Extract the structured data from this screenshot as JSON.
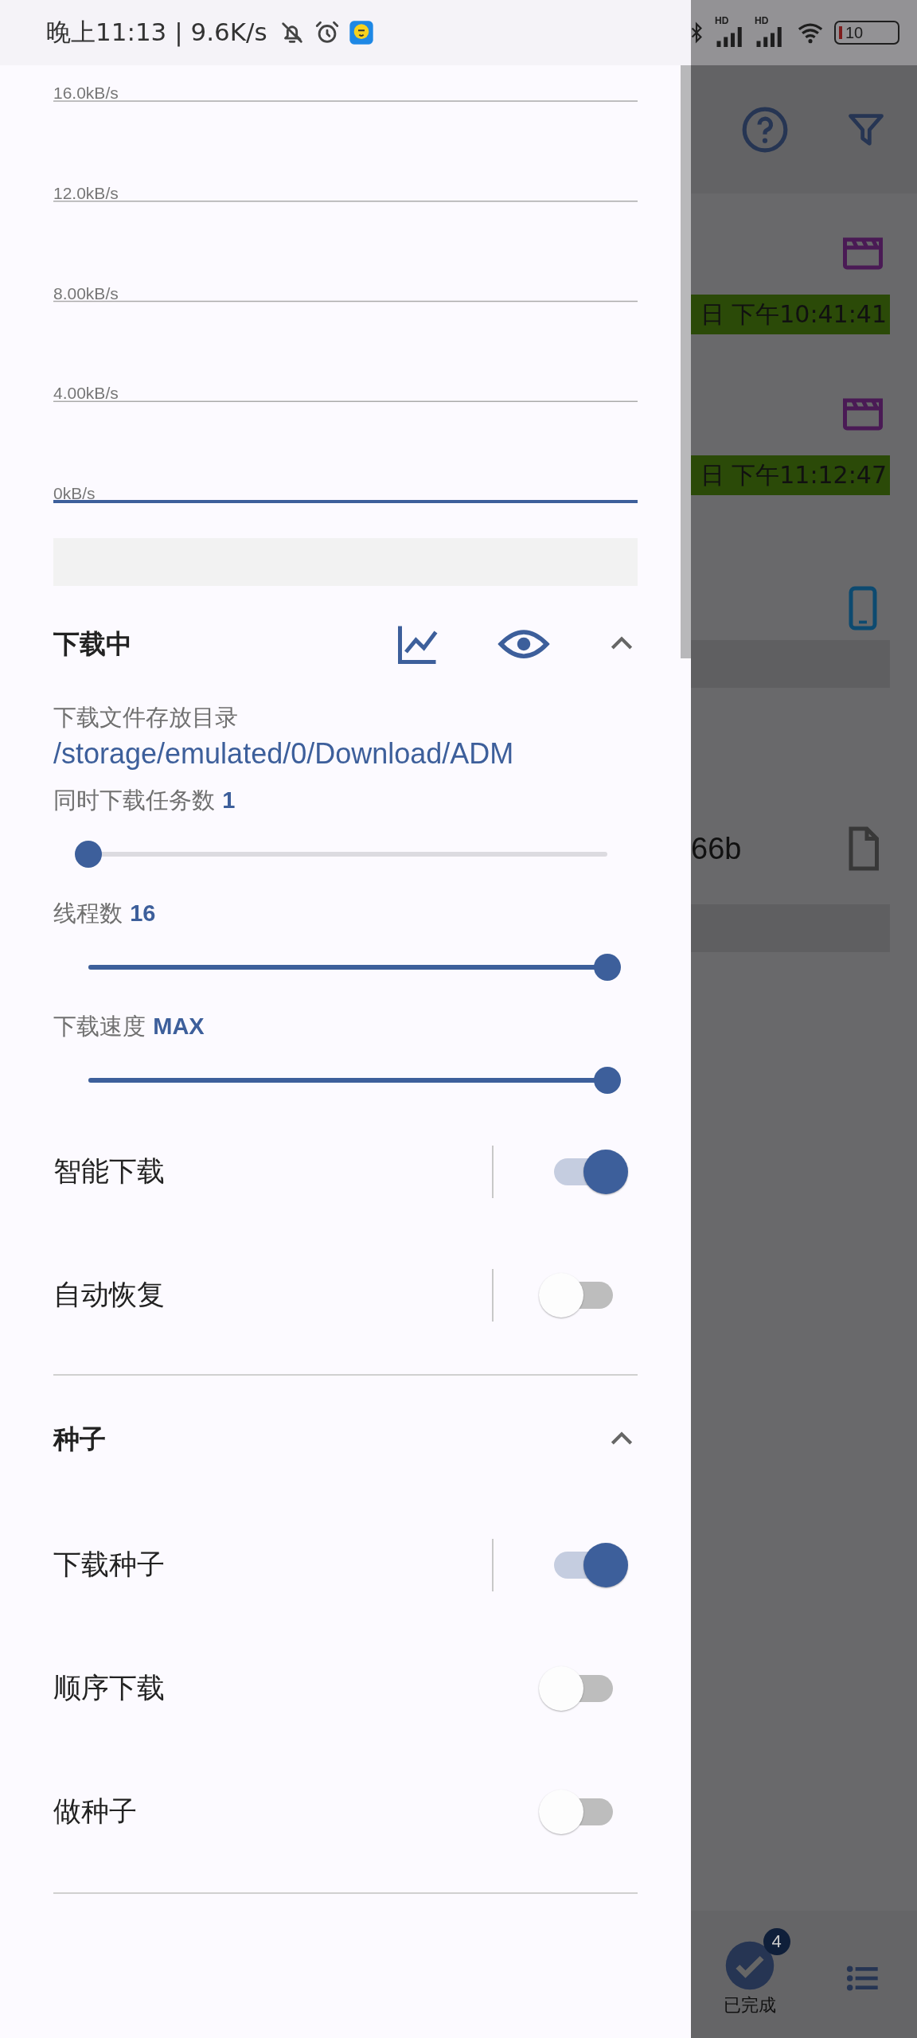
{
  "status_bar": {
    "time_speed": "晚上11:13 | 9.6K/s",
    "signals": [
      {
        "label": "HD"
      },
      {
        "label": "HD"
      }
    ],
    "battery": "10"
  },
  "chart": {
    "y_labels": [
      "16.0kB/s",
      "12.0kB/s",
      "8.00kB/s",
      "4.00kB/s",
      "0kB/s"
    ]
  },
  "downloading": {
    "title": "下载中",
    "expanded": true,
    "directory_label": "下载文件存放目录",
    "directory_path": "/storage/emulated/0/Download/ADM",
    "sliders": [
      {
        "label": "同时下载任务数",
        "reading": "1",
        "level": 0
      },
      {
        "label": "线程数",
        "reading": "16",
        "level": 1
      },
      {
        "label": "下载速度",
        "reading": "MAX",
        "level": 1
      }
    ],
    "toggles": [
      {
        "label": "智能下载",
        "on": true,
        "separator": true
      },
      {
        "label": "自动恢复",
        "on": false,
        "separator": true
      }
    ]
  },
  "torrent": {
    "title": "种子",
    "expanded": true,
    "toggles": [
      {
        "label": "下载种子",
        "on": true,
        "separator": true
      },
      {
        "label": "顺序下载",
        "on": false,
        "separator": false
      },
      {
        "label": "做种子",
        "on": false,
        "separator": false
      }
    ]
  },
  "background": {
    "rows": [
      {
        "kind": "video",
        "timestamp": "日 下午10:41:41"
      },
      {
        "kind": "video",
        "timestamp": "日 下午11:12:47"
      },
      {
        "kind": "app"
      },
      {
        "kind": "file",
        "name": "66b"
      }
    ],
    "bottom_nav": {
      "badge": "4",
      "label": "已完成"
    }
  }
}
